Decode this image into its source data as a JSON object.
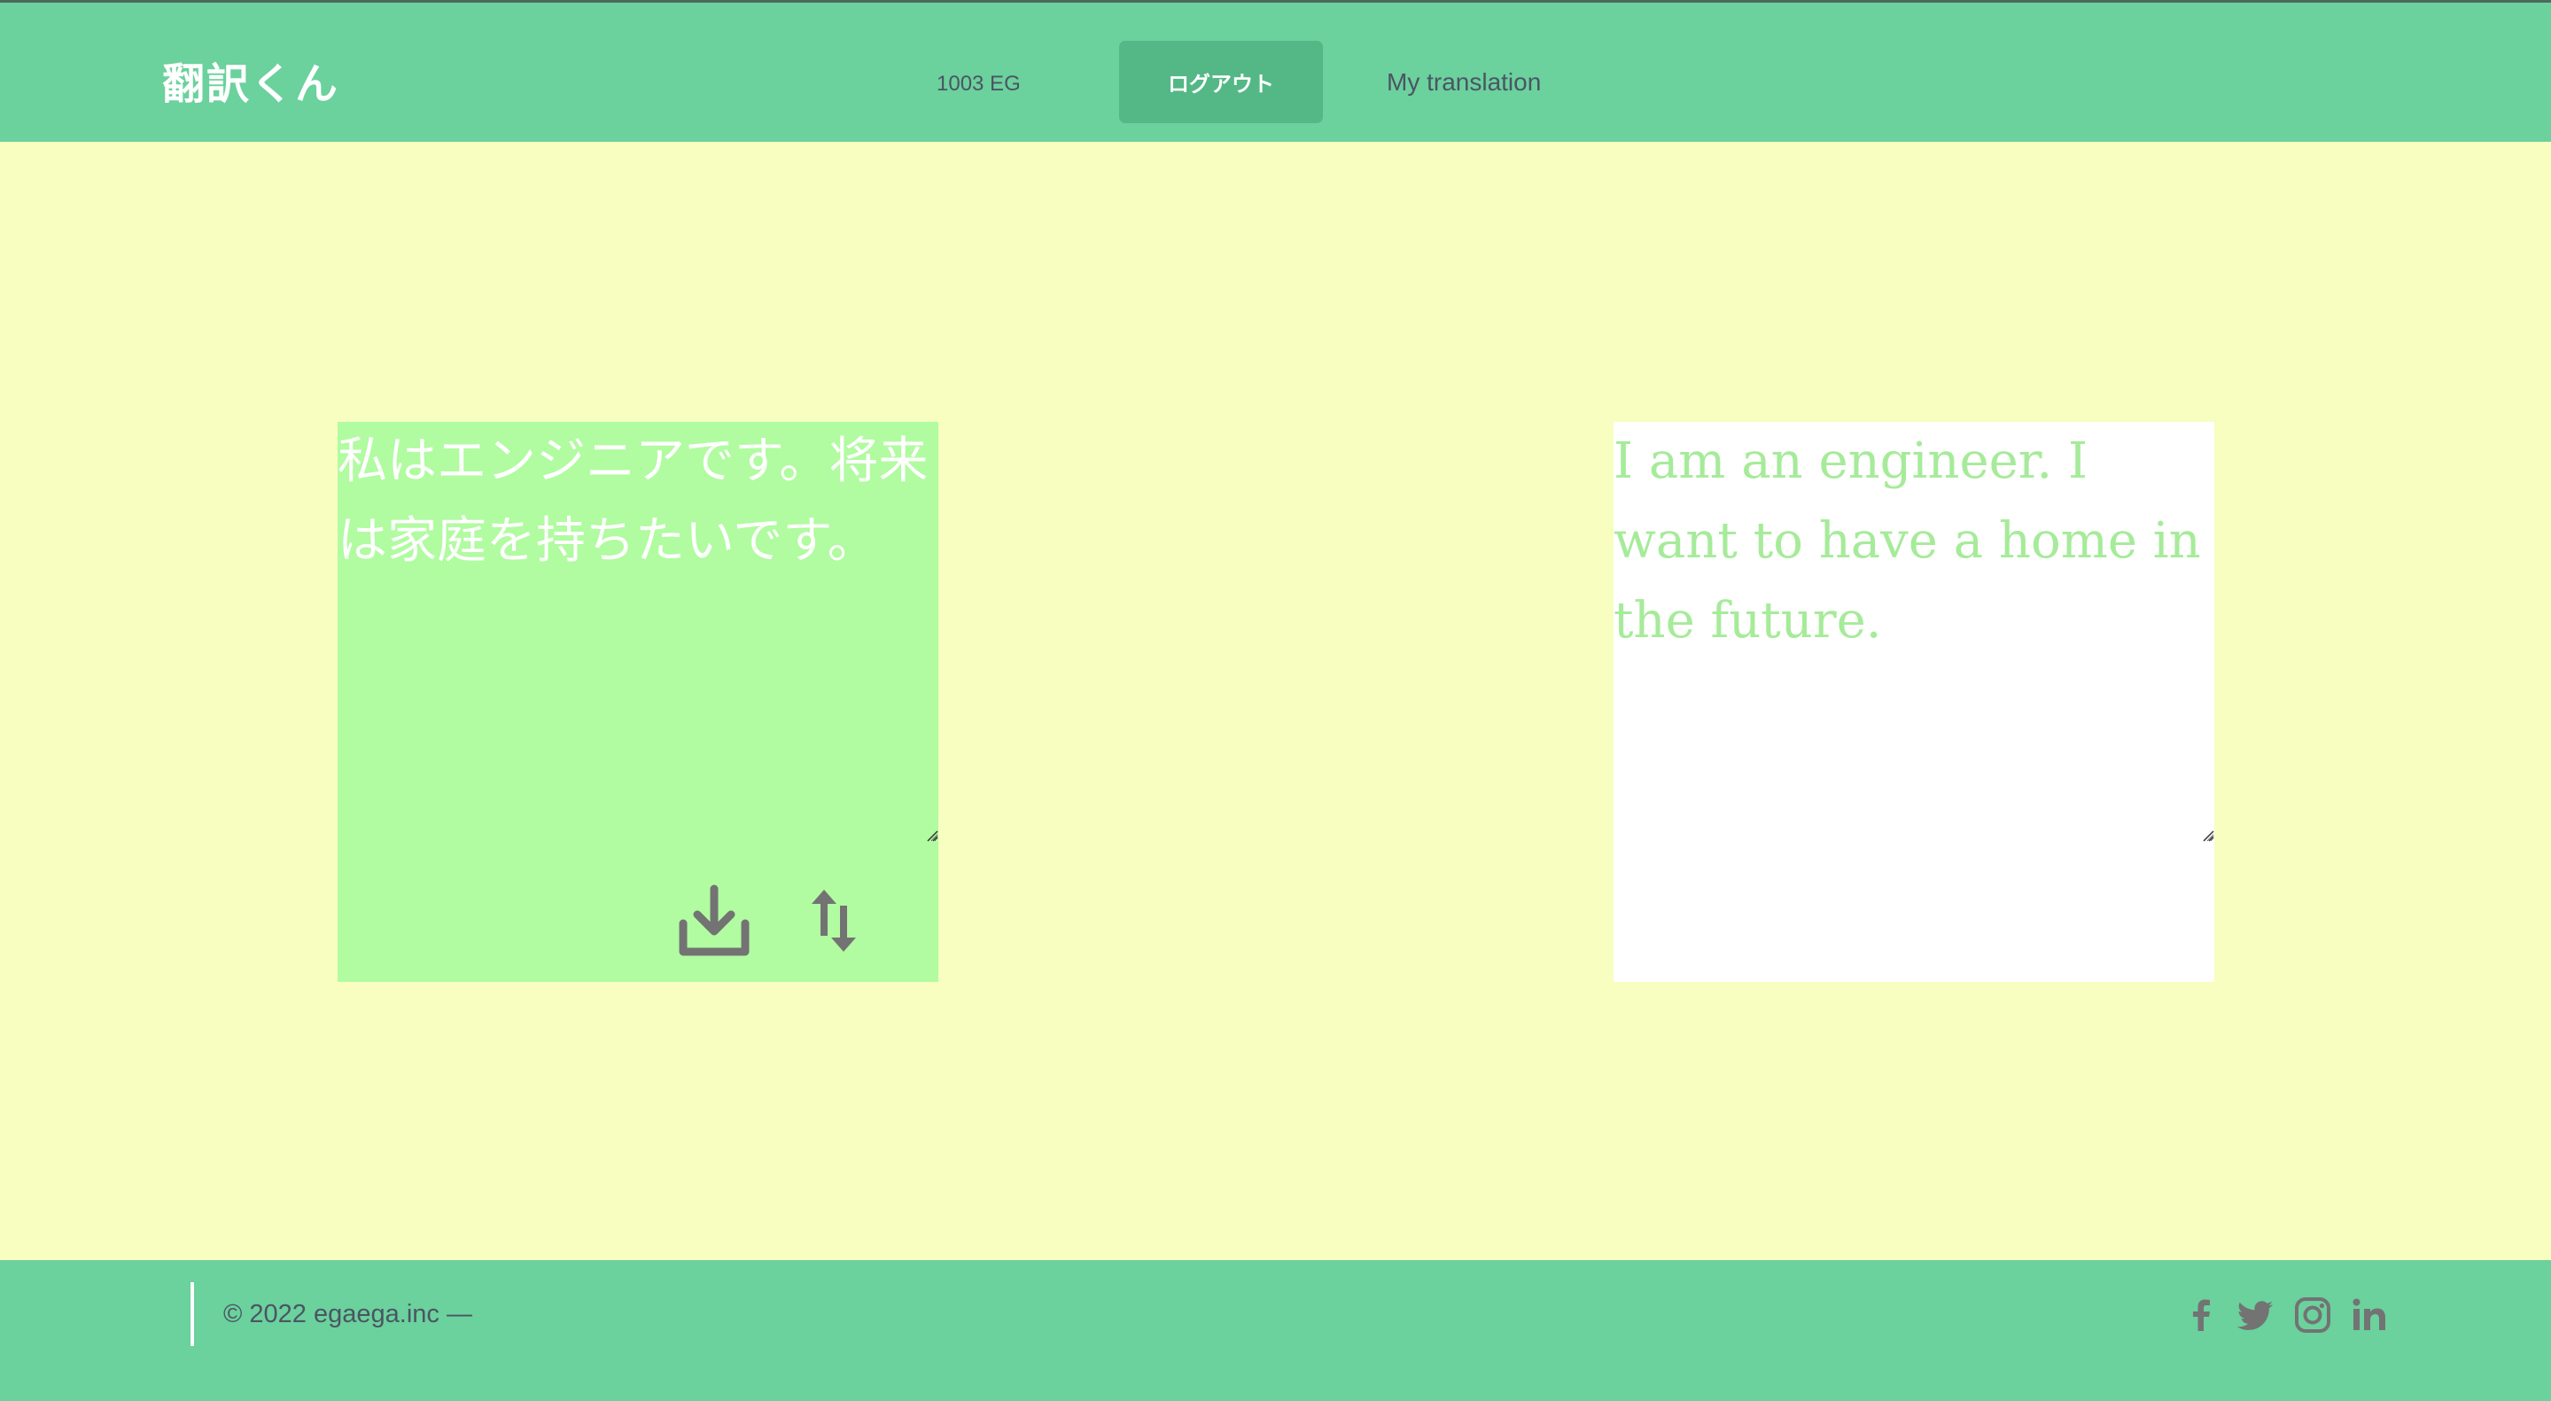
{
  "header": {
    "brand": "翻訳くん",
    "balance": "1003 EG",
    "logout_label": "ログアウト",
    "my_translation_label": "My translation"
  },
  "main": {
    "source_text": "私はエンジニアです。将来は家庭を持ちたいです。",
    "translated_text": "I am an engineer. I want to have a home in the future.",
    "actions": {
      "download_icon": "download-icon",
      "swap_icon": "swap-vertical-icon"
    }
  },
  "footer": {
    "copyright": "© 2022 egaega.inc —",
    "social": [
      "facebook-icon",
      "twitter-icon",
      "instagram-icon",
      "linkedin-icon"
    ]
  },
  "colors": {
    "header_bg": "#6bd19d",
    "page_bg": "#f7fec0",
    "logout_bg": "#54b886",
    "source_pane_bg": "#b1fba1",
    "translated_text": "#a6eb9a",
    "muted_text": "#4b5563",
    "icon_gray": "#737373"
  }
}
